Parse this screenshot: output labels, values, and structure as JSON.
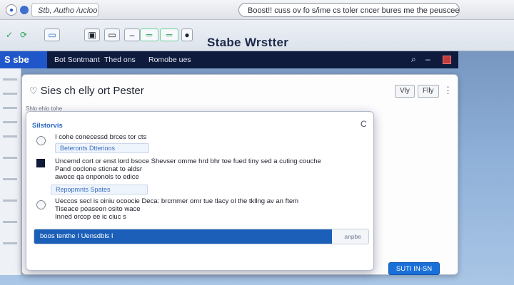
{
  "browser": {
    "tab_title": "Stb, Autho /ucloo",
    "address": "Boost!! cuss ov fo s/ime cs toler cncer bures me the peuscee ueelo"
  },
  "toolbar": {
    "app_title": "Stabe Wrstter"
  },
  "nav": {
    "logo": "S sbe",
    "links": [
      "Bot Sontmant",
      "Thed ons",
      "Romobe ues"
    ]
  },
  "window": {
    "title": "Sies ch elly ort Pester",
    "buttons": [
      "Vly",
      "Flly"
    ]
  },
  "dialog": {
    "tab_label": "Shlo   ehlo   tohe",
    "title": "Silstorvis",
    "option1": {
      "text": "I cohe conecessd brces tor cts",
      "field": "Beteronts Dtterioos"
    },
    "option2": {
      "text_lines": [
        "Uncemd cort or enst lord bsoce  Shevser omme hrd bhr toe fued tiny  sed a cuting couche",
        "Pand ooclone sticnat to aldsr",
        "awoce qa  onponols to edice"
      ],
      "field": "Repopmnts Spates"
    },
    "option3": {
      "text_lines": [
        "Ueccos secl is oiniu ocoocie  Deca: brcmmer omr tue tlacy ol the tkllng av an ftem",
        "Tiseace poaseon osito wace",
        "Inned orcop ee ic ciuc s"
      ]
    },
    "progress": {
      "label": "boos tenthe  I Uensdbls I",
      "side": "anpbe",
      "percent": 89
    }
  },
  "footer": {
    "primary_button": "SUTI IN-SN"
  },
  "colors": {
    "nav_bg": "#0e1b3d",
    "accent": "#1a6fd8",
    "logo_bg": "#1f56c9",
    "dialog_title": "#2b67c4"
  }
}
